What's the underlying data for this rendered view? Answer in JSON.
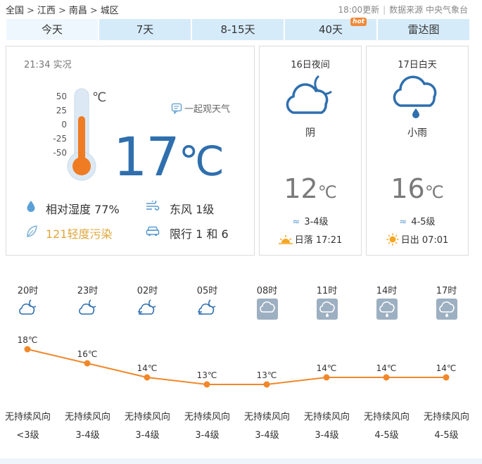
{
  "breadcrumb": {
    "country": "全国",
    "province": "江西",
    "city": "南昌",
    "district": "城区",
    "separator": ">"
  },
  "source": {
    "updated": "18:00更新",
    "text": "数据来源 中央气象台"
  },
  "tabs": [
    {
      "label": "今天",
      "active": true
    },
    {
      "label": "7天"
    },
    {
      "label": "8-15天"
    },
    {
      "label": "40天",
      "badge": "hot"
    },
    {
      "label": "雷达图"
    }
  ],
  "now": {
    "obs_time": "21:34 实况",
    "scale": [
      "50",
      "25",
      "0",
      "-25",
      "-50"
    ],
    "unit": "℃",
    "together": "一起观天气",
    "temp": "17",
    "temp_unit": "℃",
    "humidity_label": "相对湿度",
    "humidity": "77%",
    "wind": "东风 1级",
    "pollution": "121轻度污染",
    "restriction": "限行 1 和 6",
    "thermo_level": 0.67
  },
  "day1": {
    "title": "16日夜间",
    "icon": "cloudy-night-icon",
    "desc": "阴",
    "temp": "12",
    "unit": "℃",
    "wind_icon": "≈",
    "wind": "3-4级",
    "sun": "日落 17:21"
  },
  "day2": {
    "title": "17日白天",
    "icon": "rain-icon",
    "desc": "小雨",
    "temp": "16",
    "unit": "℃",
    "wind_icon": "≈",
    "wind": "4-5级",
    "sun": "日出 07:01"
  },
  "hourly": [
    {
      "time": "20时",
      "icon": "cloudy-night",
      "temp": "18℃",
      "wind_dir": "无持续风向",
      "wind_level": "<3级"
    },
    {
      "time": "23时",
      "icon": "cloudy-night",
      "temp": "16℃",
      "wind_dir": "无持续风向",
      "wind_level": "3-4级"
    },
    {
      "time": "02时",
      "icon": "cloudy-night-wind",
      "temp": "14℃",
      "wind_dir": "无持续风向",
      "wind_level": "3-4级"
    },
    {
      "time": "05时",
      "icon": "cloudy-night-wind",
      "temp": "13℃",
      "wind_dir": "无持续风向",
      "wind_level": "3-4级"
    },
    {
      "time": "08时",
      "icon": "overcast",
      "temp": "13℃",
      "wind_dir": "无持续风向",
      "wind_level": "3-4级"
    },
    {
      "time": "11时",
      "icon": "light-rain",
      "temp": "14℃",
      "wind_dir": "无持续风向",
      "wind_level": "3-4级"
    },
    {
      "time": "14时",
      "icon": "light-rain",
      "temp": "14℃",
      "wind_dir": "无持续风向",
      "wind_level": "4-5级"
    },
    {
      "time": "17时",
      "icon": "light-rain",
      "temp": "14℃",
      "wind_dir": "无持续风向",
      "wind_level": "4-5级"
    }
  ],
  "chart_data": {
    "type": "line",
    "categories": [
      "20时",
      "23时",
      "02时",
      "05时",
      "08时",
      "11时",
      "14时",
      "17时"
    ],
    "values": [
      18,
      16,
      14,
      13,
      13,
      14,
      14,
      14
    ],
    "unit": "℃",
    "color": "#f0882a"
  },
  "colors": {
    "accent": "#2f6fae",
    "tab_bg": "#d6ebfa",
    "line": "#f0882a",
    "pollution": "#e0a53a"
  }
}
